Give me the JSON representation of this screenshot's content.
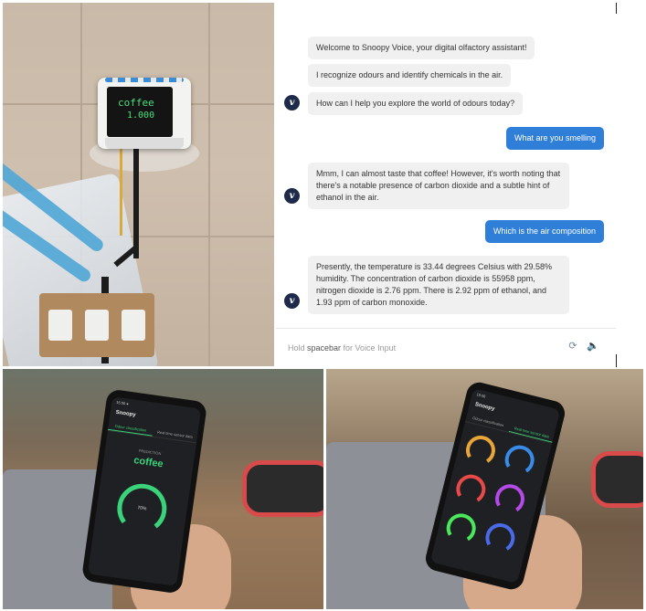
{
  "device": {
    "line1": "coffee",
    "line2": "1.000"
  },
  "chat": {
    "messages": [
      {
        "from": "assistant",
        "text": "Welcome to Snoopy Voice, your digital olfactory assistant!"
      },
      {
        "from": "assistant",
        "text": "I recognize odours and identify chemicals in the air."
      },
      {
        "from": "assistant",
        "text": "How can I help you explore the world of odours today?"
      },
      {
        "from": "user",
        "text": "What are you smelling"
      },
      {
        "from": "assistant",
        "text": "Mmm, I can almost taste that coffee! However, it's worth noting that there's a notable presence of carbon dioxide and a subtle hint of ethanol in the air."
      },
      {
        "from": "user",
        "text": "Which is the air composition"
      },
      {
        "from": "assistant",
        "text": "Presently, the temperature is 33.44 degrees Celsius with 29.58% humidity. The concentration of carbon dioxide is 55958 ppm, nitrogen dioxide is 2.76 ppm. There is 2.92 ppm of ethanol, and 1.93 ppm of carbon monoxide."
      }
    ],
    "avatar_letter": "v",
    "input_prefix": "Hold ",
    "input_key": "spacebar",
    "input_suffix": " for Voice Input",
    "icons": [
      "refresh-icon",
      "speaker-icon"
    ]
  },
  "phone_left": {
    "status": "15:06 ●",
    "app_title": "Snoopy",
    "tabs": [
      "Odour classification",
      "Real time sensor data"
    ],
    "label": "PREDICTION",
    "prediction": "coffee",
    "gauge_value": "70%"
  },
  "phone_right": {
    "status": "15:06",
    "app_title": "Snoopy",
    "tabs": [
      "Odour classification",
      "Real time sensor data"
    ]
  },
  "colors": {
    "accent_blue": "#2f7fd8",
    "assistant_bubble": "#f0f0f0",
    "green": "#3ad27a"
  }
}
